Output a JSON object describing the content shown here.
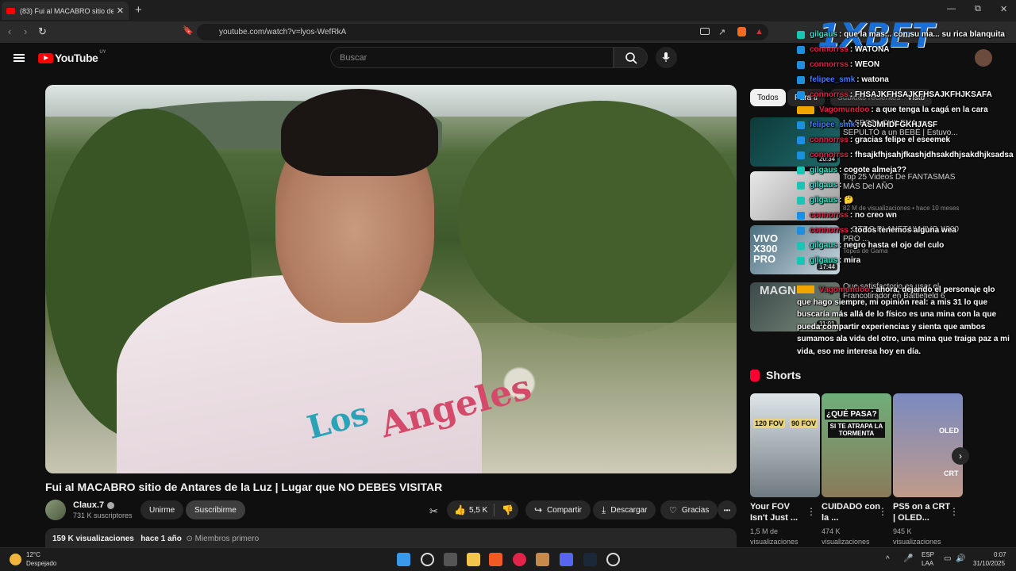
{
  "browser": {
    "tab_title": "(83) Fui al MACABRO sitio de An",
    "tab_close": "✕",
    "new_tab": "+",
    "url": "youtube.com/watch?v=lyos-WefRkA",
    "win_min": "—",
    "win_max": "⧉",
    "win_close": "✕"
  },
  "youtube": {
    "logo_text": "YouTube",
    "country_code": "UY",
    "search_placeholder": "Buscar"
  },
  "video": {
    "shirt_text_1": "Los",
    "shirt_text_2": "Angeles",
    "title": "Fui al MACABRO sitio de Antares de la Luz | Lugar que NO DEBES VISITAR",
    "channel": "Claux.7",
    "subscribers": "731 K suscriptores",
    "join_label": "Unirme",
    "subscribe_label": "Suscribirme",
    "likes": "5,5 K",
    "share_label": "Compartir",
    "download_label": "Descargar",
    "thanks_label": "Gracias",
    "more": "•••",
    "views": "159 K visualizaciones",
    "age": "hace 1 año",
    "members": "Miembros primero"
  },
  "right": {
    "chips": [
      "Todos",
      "Para ti",
      "Subidas recientes",
      "Visto"
    ],
    "recommendations": [
      {
        "title": "LA SECTA CHILENA que SEPULTÓ a un BEBÉ | Estuvo...",
        "meta": "",
        "duration": "20:34"
      },
      {
        "title": "Top 25 Videos De FANTASMAS MÁS Del AÑO",
        "meta": "82 M de visualizaciones • hace 10 meses",
        "duration": ""
      },
      {
        "title": "... OTRO PLANETA!! VIVO X300 PRO ...",
        "meta": "Topes de Gama",
        "duration": "17:44"
      },
      {
        "title": "Que satisfactorio es usar el Francotirador en Battlefield 6",
        "meta": "",
        "duration": "11:01"
      }
    ],
    "thumb_text_vivo": "VIVO X300 PRO",
    "thumb_text_magn": "MAGN",
    "shorts_heading": "Shorts",
    "shorts": [
      {
        "title": "Your FOV Isn't Just ...",
        "meta": "1,5 M de visualizaciones",
        "thumb_a": "120 FOV",
        "thumb_b": "90 FOV"
      },
      {
        "title": "CUIDADO con la ...",
        "meta": "474 K visualizaciones",
        "thumb_a": "¿QUÉ PASA?",
        "thumb_b": "SI TE ATRAPA LA TORMENTA"
      },
      {
        "title": "PS5 on a CRT | OLED...",
        "meta": "945 K visualizaciones",
        "thumb_a": "OLED",
        "thumb_b": "CRT"
      }
    ],
    "next_arrow": "›",
    "dots": "⋮"
  },
  "chat": {
    "brand": "1XBET",
    "messages": [
      {
        "user": "gilgaus",
        "text": ": que la mas... con su ma... su rica blanquita",
        "badge": "teal",
        "ucolor": "teal"
      },
      {
        "user": "connorrss",
        "text": ": WATONA",
        "badge": "blue",
        "ucolor": "red"
      },
      {
        "user": "connorrss",
        "text": ": WEON",
        "badge": "blue",
        "ucolor": "red"
      },
      {
        "user": "felipee_smk",
        "text": ": watona",
        "badge": "blue",
        "ucolor": "blue"
      },
      {
        "user": "connorrss",
        "text": ": FHSAJKFHSAJKFHSAJKFHJKSAFA",
        "badge": "blue",
        "ucolor": "red"
      },
      {
        "user": "Vagomundoo",
        "text": ": a que tenga la cagá en la cara",
        "badge": "gold",
        "ucolor": "red"
      },
      {
        "user": "felipee_smk",
        "text": ": ASJMHDFGKHJASF",
        "badge": "blue",
        "ucolor": "blue"
      },
      {
        "user": "connorrss",
        "text": ": gracias felipe el eseemek",
        "badge": "blue",
        "ucolor": "red"
      },
      {
        "user": "connorrss",
        "text": ": fhsajkfhjsahjfkashjdhsakdhjsakdhjksadsa",
        "badge": "blue",
        "ucolor": "red"
      },
      {
        "user": "gilgaus",
        "text": ": cogote almeja??",
        "badge": "teal",
        "ucolor": "teal"
      },
      {
        "user": "gilgaus",
        "text": ":",
        "badge": "teal",
        "ucolor": "teal"
      },
      {
        "user": "gilgaus",
        "text": ": 🤔",
        "badge": "teal",
        "ucolor": "teal"
      },
      {
        "user": "connorrss",
        "text": ": no creo wn",
        "badge": "blue",
        "ucolor": "red"
      },
      {
        "user": "connorrss",
        "text": ": todos tenemos alguna wea",
        "badge": "blue",
        "ucolor": "red"
      },
      {
        "user": "gilgaus",
        "text": ": negro hasta el ojo del culo",
        "badge": "teal",
        "ucolor": "teal"
      },
      {
        "user": "gilgaus",
        "text": ": mira",
        "badge": "teal",
        "ucolor": "teal"
      }
    ],
    "long_message_user": "Vagomundoo",
    "long_message_text": ": ahora, dejando el personaje qlo que hago siempre, mi opinión real: a mis 31 lo que buscaría más allá de lo físico es una mina con la que pueda compartir experiencias y sienta que ambos sumamos ala vida del otro, una mina que traiga paz a mi vida, eso me interesa hoy en día."
  },
  "taskbar": {
    "temp": "12°C",
    "weather": "Despejado",
    "lang1": "ESP",
    "lang2": "LAA",
    "time": "0:07",
    "date": "31/10/2025"
  }
}
